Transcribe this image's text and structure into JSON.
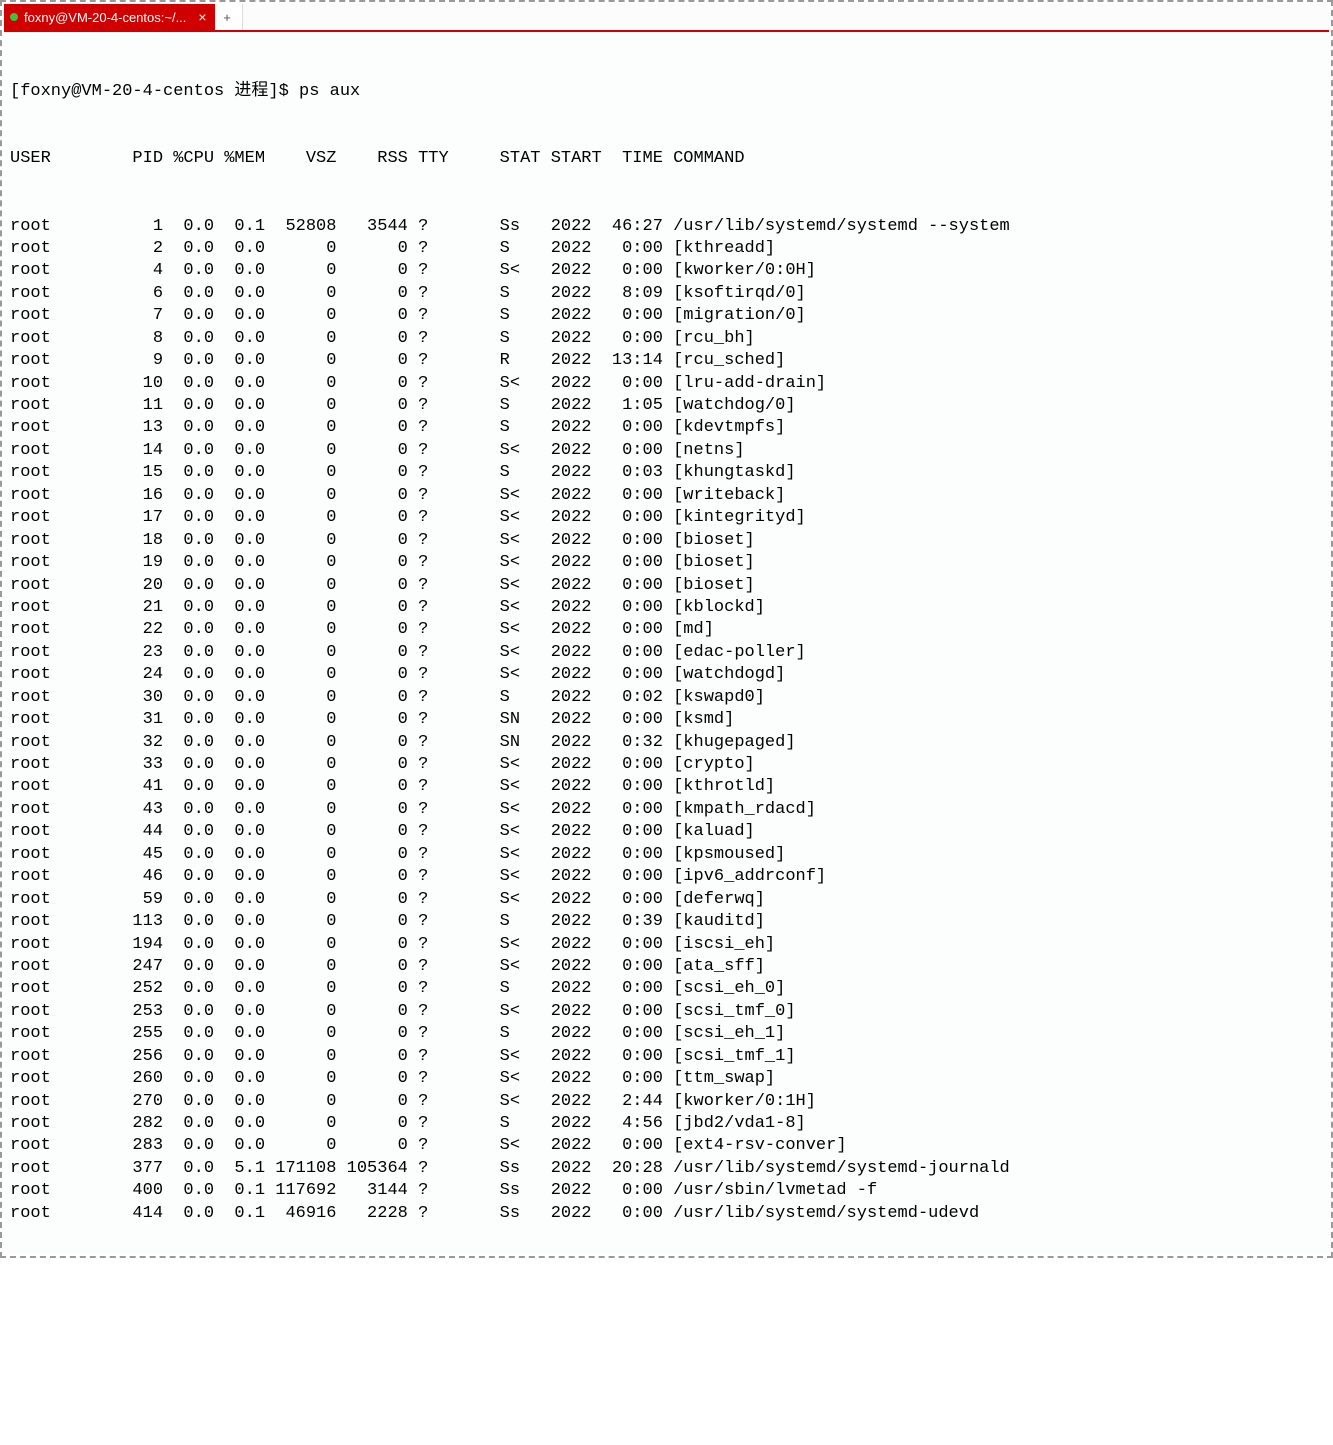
{
  "tab": {
    "title": "foxny@VM-20-4-centos:~/...",
    "close": "×",
    "new": "+"
  },
  "terminal": {
    "prompt": "[foxny@VM-20-4-centos 进程]$ ",
    "command": "ps aux",
    "headers": [
      "USER",
      "PID",
      "%CPU",
      "%MEM",
      "VSZ",
      "RSS",
      "TTY",
      "STAT",
      "START",
      "TIME",
      "COMMAND"
    ],
    "rows": [
      [
        "root",
        "1",
        "0.0",
        "0.1",
        "52808",
        "3544",
        "?",
        "Ss",
        "2022",
        "46:27",
        "/usr/lib/systemd/systemd --system"
      ],
      [
        "root",
        "2",
        "0.0",
        "0.0",
        "0",
        "0",
        "?",
        "S",
        "2022",
        "0:00",
        "[kthreadd]"
      ],
      [
        "root",
        "4",
        "0.0",
        "0.0",
        "0",
        "0",
        "?",
        "S<",
        "2022",
        "0:00",
        "[kworker/0:0H]"
      ],
      [
        "root",
        "6",
        "0.0",
        "0.0",
        "0",
        "0",
        "?",
        "S",
        "2022",
        "8:09",
        "[ksoftirqd/0]"
      ],
      [
        "root",
        "7",
        "0.0",
        "0.0",
        "0",
        "0",
        "?",
        "S",
        "2022",
        "0:00",
        "[migration/0]"
      ],
      [
        "root",
        "8",
        "0.0",
        "0.0",
        "0",
        "0",
        "?",
        "S",
        "2022",
        "0:00",
        "[rcu_bh]"
      ],
      [
        "root",
        "9",
        "0.0",
        "0.0",
        "0",
        "0",
        "?",
        "R",
        "2022",
        "13:14",
        "[rcu_sched]"
      ],
      [
        "root",
        "10",
        "0.0",
        "0.0",
        "0",
        "0",
        "?",
        "S<",
        "2022",
        "0:00",
        "[lru-add-drain]"
      ],
      [
        "root",
        "11",
        "0.0",
        "0.0",
        "0",
        "0",
        "?",
        "S",
        "2022",
        "1:05",
        "[watchdog/0]"
      ],
      [
        "root",
        "13",
        "0.0",
        "0.0",
        "0",
        "0",
        "?",
        "S",
        "2022",
        "0:00",
        "[kdevtmpfs]"
      ],
      [
        "root",
        "14",
        "0.0",
        "0.0",
        "0",
        "0",
        "?",
        "S<",
        "2022",
        "0:00",
        "[netns]"
      ],
      [
        "root",
        "15",
        "0.0",
        "0.0",
        "0",
        "0",
        "?",
        "S",
        "2022",
        "0:03",
        "[khungtaskd]"
      ],
      [
        "root",
        "16",
        "0.0",
        "0.0",
        "0",
        "0",
        "?",
        "S<",
        "2022",
        "0:00",
        "[writeback]"
      ],
      [
        "root",
        "17",
        "0.0",
        "0.0",
        "0",
        "0",
        "?",
        "S<",
        "2022",
        "0:00",
        "[kintegrityd]"
      ],
      [
        "root",
        "18",
        "0.0",
        "0.0",
        "0",
        "0",
        "?",
        "S<",
        "2022",
        "0:00",
        "[bioset]"
      ],
      [
        "root",
        "19",
        "0.0",
        "0.0",
        "0",
        "0",
        "?",
        "S<",
        "2022",
        "0:00",
        "[bioset]"
      ],
      [
        "root",
        "20",
        "0.0",
        "0.0",
        "0",
        "0",
        "?",
        "S<",
        "2022",
        "0:00",
        "[bioset]"
      ],
      [
        "root",
        "21",
        "0.0",
        "0.0",
        "0",
        "0",
        "?",
        "S<",
        "2022",
        "0:00",
        "[kblockd]"
      ],
      [
        "root",
        "22",
        "0.0",
        "0.0",
        "0",
        "0",
        "?",
        "S<",
        "2022",
        "0:00",
        "[md]"
      ],
      [
        "root",
        "23",
        "0.0",
        "0.0",
        "0",
        "0",
        "?",
        "S<",
        "2022",
        "0:00",
        "[edac-poller]"
      ],
      [
        "root",
        "24",
        "0.0",
        "0.0",
        "0",
        "0",
        "?",
        "S<",
        "2022",
        "0:00",
        "[watchdogd]"
      ],
      [
        "root",
        "30",
        "0.0",
        "0.0",
        "0",
        "0",
        "?",
        "S",
        "2022",
        "0:02",
        "[kswapd0]"
      ],
      [
        "root",
        "31",
        "0.0",
        "0.0",
        "0",
        "0",
        "?",
        "SN",
        "2022",
        "0:00",
        "[ksmd]"
      ],
      [
        "root",
        "32",
        "0.0",
        "0.0",
        "0",
        "0",
        "?",
        "SN",
        "2022",
        "0:32",
        "[khugepaged]"
      ],
      [
        "root",
        "33",
        "0.0",
        "0.0",
        "0",
        "0",
        "?",
        "S<",
        "2022",
        "0:00",
        "[crypto]"
      ],
      [
        "root",
        "41",
        "0.0",
        "0.0",
        "0",
        "0",
        "?",
        "S<",
        "2022",
        "0:00",
        "[kthrotld]"
      ],
      [
        "root",
        "43",
        "0.0",
        "0.0",
        "0",
        "0",
        "?",
        "S<",
        "2022",
        "0:00",
        "[kmpath_rdacd]"
      ],
      [
        "root",
        "44",
        "0.0",
        "0.0",
        "0",
        "0",
        "?",
        "S<",
        "2022",
        "0:00",
        "[kaluad]"
      ],
      [
        "root",
        "45",
        "0.0",
        "0.0",
        "0",
        "0",
        "?",
        "S<",
        "2022",
        "0:00",
        "[kpsmoused]"
      ],
      [
        "root",
        "46",
        "0.0",
        "0.0",
        "0",
        "0",
        "?",
        "S<",
        "2022",
        "0:00",
        "[ipv6_addrconf]"
      ],
      [
        "root",
        "59",
        "0.0",
        "0.0",
        "0",
        "0",
        "?",
        "S<",
        "2022",
        "0:00",
        "[deferwq]"
      ],
      [
        "root",
        "113",
        "0.0",
        "0.0",
        "0",
        "0",
        "?",
        "S",
        "2022",
        "0:39",
        "[kauditd]"
      ],
      [
        "root",
        "194",
        "0.0",
        "0.0",
        "0",
        "0",
        "?",
        "S<",
        "2022",
        "0:00",
        "[iscsi_eh]"
      ],
      [
        "root",
        "247",
        "0.0",
        "0.0",
        "0",
        "0",
        "?",
        "S<",
        "2022",
        "0:00",
        "[ata_sff]"
      ],
      [
        "root",
        "252",
        "0.0",
        "0.0",
        "0",
        "0",
        "?",
        "S",
        "2022",
        "0:00",
        "[scsi_eh_0]"
      ],
      [
        "root",
        "253",
        "0.0",
        "0.0",
        "0",
        "0",
        "?",
        "S<",
        "2022",
        "0:00",
        "[scsi_tmf_0]"
      ],
      [
        "root",
        "255",
        "0.0",
        "0.0",
        "0",
        "0",
        "?",
        "S",
        "2022",
        "0:00",
        "[scsi_eh_1]"
      ],
      [
        "root",
        "256",
        "0.0",
        "0.0",
        "0",
        "0",
        "?",
        "S<",
        "2022",
        "0:00",
        "[scsi_tmf_1]"
      ],
      [
        "root",
        "260",
        "0.0",
        "0.0",
        "0",
        "0",
        "?",
        "S<",
        "2022",
        "0:00",
        "[ttm_swap]"
      ],
      [
        "root",
        "270",
        "0.0",
        "0.0",
        "0",
        "0",
        "?",
        "S<",
        "2022",
        "2:44",
        "[kworker/0:1H]"
      ],
      [
        "root",
        "282",
        "0.0",
        "0.0",
        "0",
        "0",
        "?",
        "S",
        "2022",
        "4:56",
        "[jbd2/vda1-8]"
      ],
      [
        "root",
        "283",
        "0.0",
        "0.0",
        "0",
        "0",
        "?",
        "S<",
        "2022",
        "0:00",
        "[ext4-rsv-conver]"
      ],
      [
        "root",
        "377",
        "0.0",
        "5.1",
        "171108",
        "105364",
        "?",
        "Ss",
        "2022",
        "20:28",
        "/usr/lib/systemd/systemd-journald"
      ],
      [
        "root",
        "400",
        "0.0",
        "0.1",
        "117692",
        "3144",
        "?",
        "Ss",
        "2022",
        "0:00",
        "/usr/sbin/lvmetad -f"
      ],
      [
        "root",
        "414",
        "0.0",
        "0.1",
        "46916",
        "2228",
        "?",
        "Ss",
        "2022",
        "0:00",
        "/usr/lib/systemd/systemd-udevd"
      ]
    ]
  }
}
